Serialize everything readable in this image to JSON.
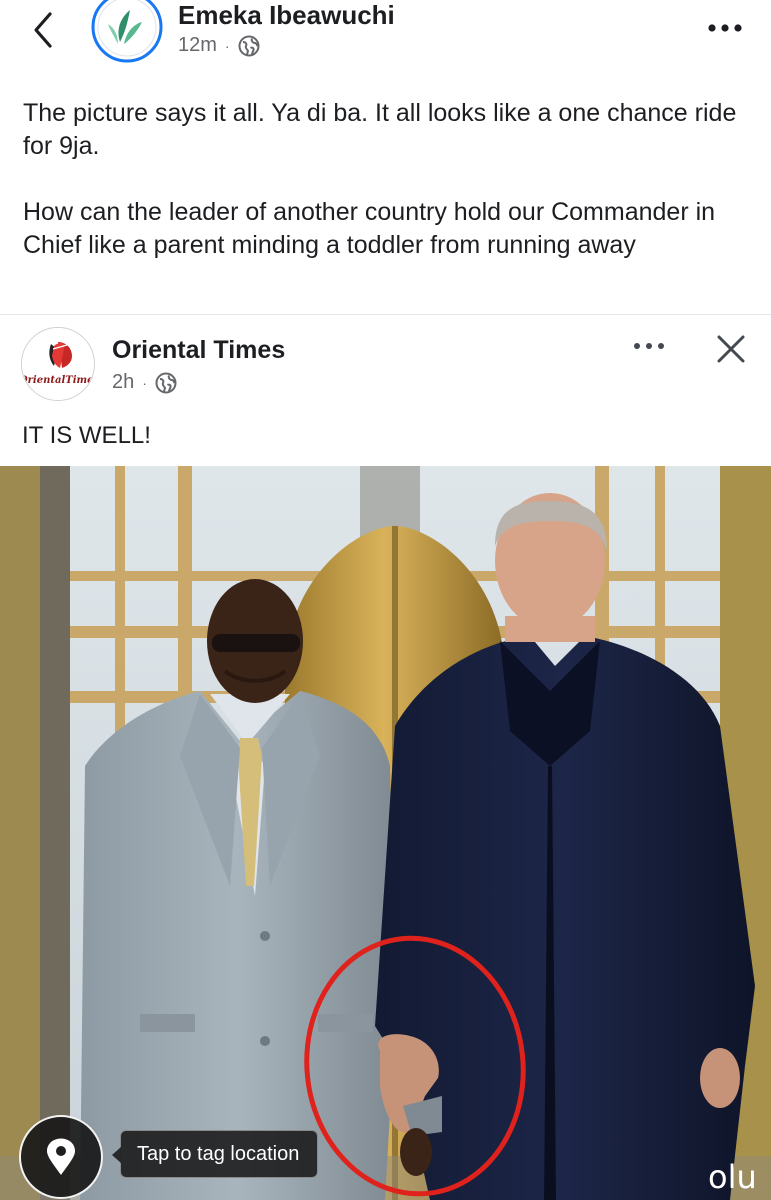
{
  "header": {
    "author_name": "Emeka Ibeawuchi",
    "timestamp": "12m",
    "separator": "·",
    "audience_icon": "globe-icon",
    "back_icon": "chevron-left-icon",
    "more_icon": "more-horizontal-icon"
  },
  "post": {
    "paragraphs": [
      "The picture says it all. Ya di ba. It all looks like a one chance ride for 9ja.",
      "How can the leader of another country hold our Commander in Chief like a parent minding a toddler from running away"
    ]
  },
  "shared_post": {
    "page_name": "Oriental Times",
    "avatar_logo_text": "OrientalTimes",
    "timestamp": "2h",
    "separator": "·",
    "audience_icon": "globe-icon",
    "more_icon": "more-horizontal-icon",
    "close_icon": "close-icon",
    "caption": "IT IS WELL!"
  },
  "photo": {
    "location_icon": "location-pin-icon",
    "tag_location_label": "Tap to tag location",
    "watermark_text": "olu"
  },
  "colors": {
    "text_primary": "#1c1e21",
    "text_secondary": "#65676b",
    "avatar_ring": "#1877f2",
    "annotation_circle": "#e0221d"
  }
}
